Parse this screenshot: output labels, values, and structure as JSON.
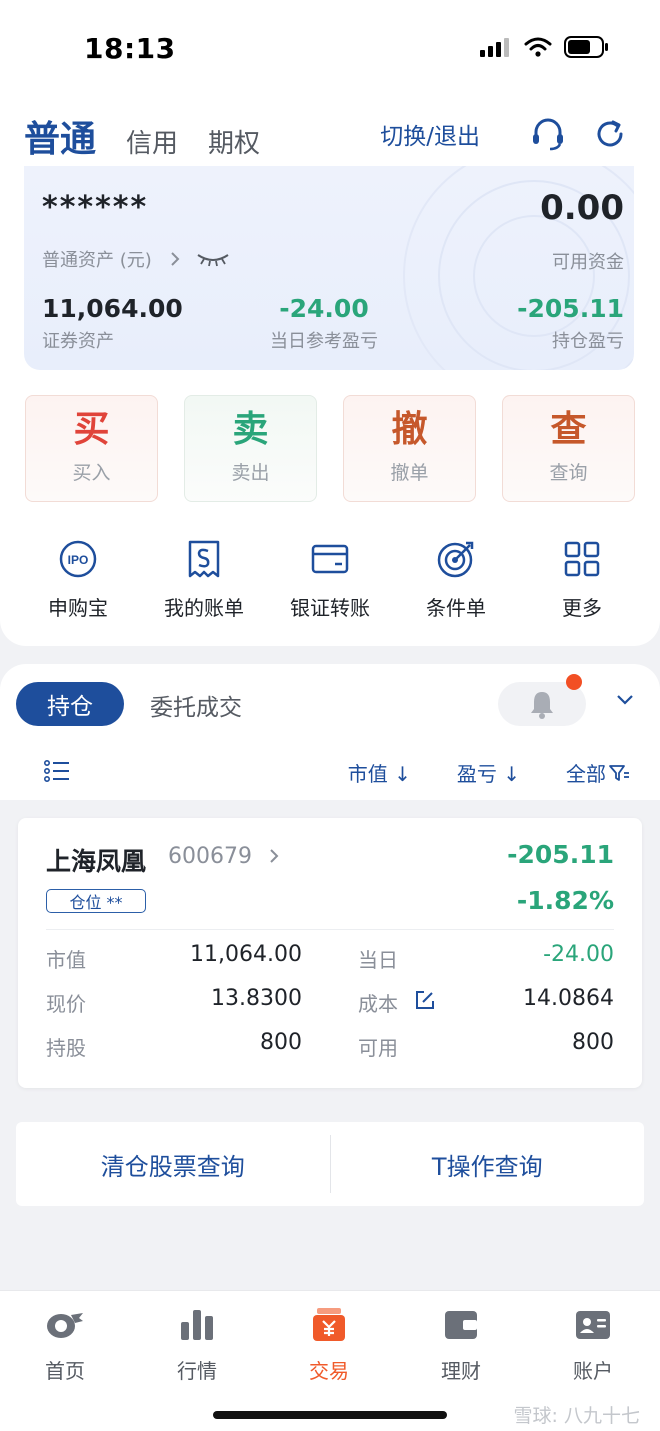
{
  "status_bar": {
    "time": "18:13"
  },
  "header": {
    "tabs": [
      "普通",
      "信用",
      "期权"
    ],
    "switch_logout": "切换/退出"
  },
  "assets": {
    "masked_total": "******",
    "total_label": "普通资产 (元)",
    "available_value": "0.00",
    "available_label": "可用资金",
    "securities_value": "11,064.00",
    "securities_label": "证券资产",
    "daily_pnl_value": "-24.00",
    "daily_pnl_label": "当日参考盈亏",
    "holding_pnl_value": "-205.11",
    "holding_pnl_label": "持仓盈亏"
  },
  "trade_buttons": [
    {
      "big": "买",
      "small": "买入",
      "color": "#e0443a"
    },
    {
      "big": "卖",
      "small": "卖出",
      "color": "#2aa57a"
    },
    {
      "big": "撤",
      "small": "撤单",
      "color": "#c6582b"
    },
    {
      "big": "查",
      "small": "查询",
      "color": "#c6582b"
    }
  ],
  "quick_actions": [
    {
      "label": "申购宝",
      "icon": "ipo-icon",
      "icon_text": "IPO"
    },
    {
      "label": "我的账单",
      "icon": "bill-icon"
    },
    {
      "label": "银证转账",
      "icon": "card-icon"
    },
    {
      "label": "条件单",
      "icon": "target-icon"
    },
    {
      "label": "更多",
      "icon": "grid-icon"
    }
  ],
  "holdings": {
    "tab_active": "持仓",
    "tab_other": "委托成交",
    "sort_market_value": "市值 ↓",
    "sort_pnl": "盈亏 ↓",
    "filter_all": "全部",
    "stock": {
      "name": "上海凤凰",
      "code": "600679",
      "pnl": "-205.11",
      "pnl_pct": "-1.82%",
      "position_badge": "仓位 **",
      "fields": {
        "market_value_label": "市值",
        "market_value": "11,064.00",
        "daily_label": "当日",
        "daily": "-24.00",
        "price_label": "现价",
        "price": "13.8300",
        "cost_label": "成本",
        "cost": "14.0864",
        "shares_label": "持股",
        "shares": "800",
        "available_label": "可用",
        "available": "800"
      }
    },
    "query_cleared": "清仓股票查询",
    "query_t": "T操作查询"
  },
  "bottom_nav": [
    {
      "label": "首页",
      "icon": "home-icon"
    },
    {
      "label": "行情",
      "icon": "chart-icon"
    },
    {
      "label": "交易",
      "icon": "trade-icon",
      "active": true
    },
    {
      "label": "理财",
      "icon": "wallet-icon"
    },
    {
      "label": "账户",
      "icon": "account-icon"
    }
  ],
  "watermark": "雪球: 八九十七",
  "colors": {
    "brand": "#1e4e9c",
    "down": "#2aa57a",
    "active_nav": "#f05a2a"
  }
}
